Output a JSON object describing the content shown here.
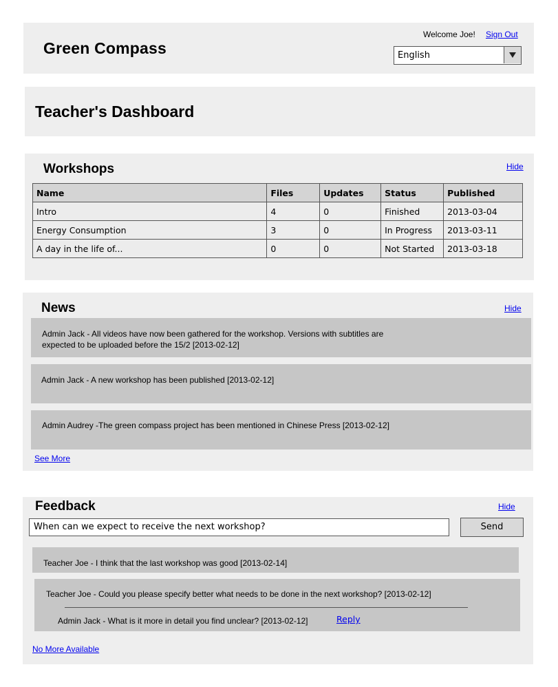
{
  "header": {
    "app_title": "Green Compass",
    "welcome_text": "Welcome Joe!",
    "sign_out": "Sign Out",
    "language": "English"
  },
  "dashboard": {
    "title": "Teacher's Dashboard"
  },
  "workshops": {
    "title": "Workshops",
    "hide": "Hide",
    "columns": [
      "Name",
      "Files",
      "Updates",
      "Status",
      "Published"
    ],
    "rows": [
      [
        "Intro",
        "4",
        "0",
        "Finished",
        "2013-03-04"
      ],
      [
        "Energy Consumption",
        "3",
        "0",
        "In Progress",
        "2013-03-11"
      ],
      [
        "A day in the life of...",
        "0",
        "0",
        "Not Started",
        "2013-03-18"
      ]
    ]
  },
  "news": {
    "title": "News",
    "hide": "Hide",
    "items": [
      "Admin Jack - All videos have now been gathered for the workshop. Versions with subtitles are expected to be uploaded  before the 15/2 [2013-02-12]",
      "Admin Jack - A new workshop has been published [2013-02-12]",
      "Admin Audrey -The green compass project has been mentioned in Chinese Press [2013-02-12]"
    ],
    "see_more": "See More"
  },
  "feedback": {
    "title": "Feedback",
    "hide": "Hide",
    "input_value": "When can we expect to receive the next workshop?",
    "send_label": "Send",
    "items": [
      "Teacher Joe - I think that the last workshop was good [2013-02-14]",
      "Teacher Joe - Could you please specify better what needs to be done in the next workshop? [2013-02-12]"
    ],
    "reply_text": "Admin Jack - What is it more in detail you find unclear? [2013-02-12]",
    "reply_link": "Reply",
    "no_more": "No More Available"
  }
}
